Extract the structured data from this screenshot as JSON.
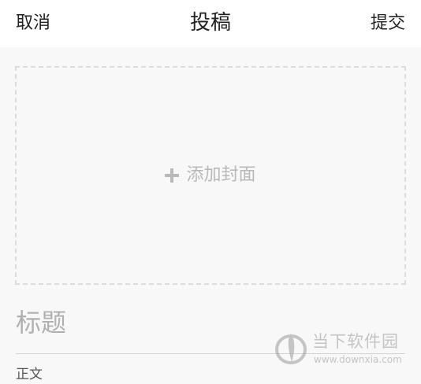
{
  "header": {
    "cancel_label": "取消",
    "title": "投稿",
    "submit_label": "提交"
  },
  "cover": {
    "icon": "plus-icon",
    "label": "添加封面"
  },
  "form": {
    "title_placeholder": "标题",
    "title_value": "",
    "body_label": "正文"
  },
  "watermark": {
    "name": "当下软件园",
    "url": "www.downxia.com"
  },
  "colors": {
    "background": "#f8f8f8",
    "header_background": "#ffffff",
    "text": "#222222",
    "placeholder": "#b9b9b9",
    "border": "#dcdcdc"
  }
}
